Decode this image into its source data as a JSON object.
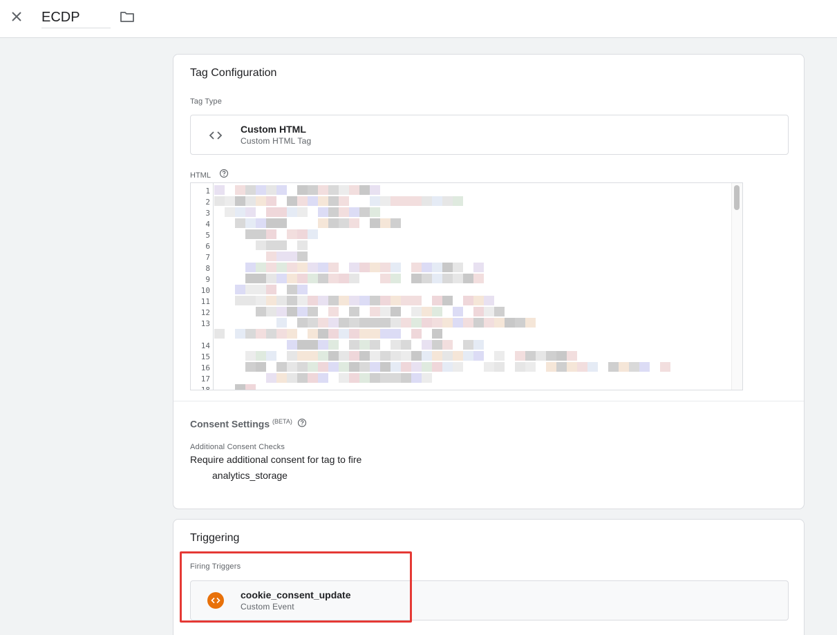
{
  "header": {
    "tag_name": "ECDP",
    "close_icon": "close-icon",
    "folder_icon": "folder-icon"
  },
  "tag_configuration": {
    "title": "Tag Configuration",
    "tag_type_label": "Tag Type",
    "tag_type": {
      "name": "Custom HTML",
      "subtitle": "Custom HTML Tag",
      "icon": "code-icon"
    },
    "html_label": "HTML",
    "html_line_numbers": [
      "1",
      "2",
      "3",
      "4",
      "5",
      "6",
      "7",
      "8",
      "9",
      "10",
      "11",
      "12",
      "13",
      "14",
      "15",
      "16",
      "17",
      "18"
    ],
    "consent": {
      "title": "Consent Settings",
      "badge": "(BETA)",
      "checks_label": "Additional Consent Checks",
      "requirement": "Require additional consent for tag to fire",
      "consent_type": "analytics_storage"
    }
  },
  "triggering": {
    "title": "Triggering",
    "firing_label": "Firing Triggers",
    "trigger": {
      "name": "cookie_consent_update",
      "type": "Custom Event",
      "icon": "custom-event-icon"
    }
  },
  "colors": {
    "trigger_icon": "#e8710a",
    "highlight": "#e53935"
  }
}
